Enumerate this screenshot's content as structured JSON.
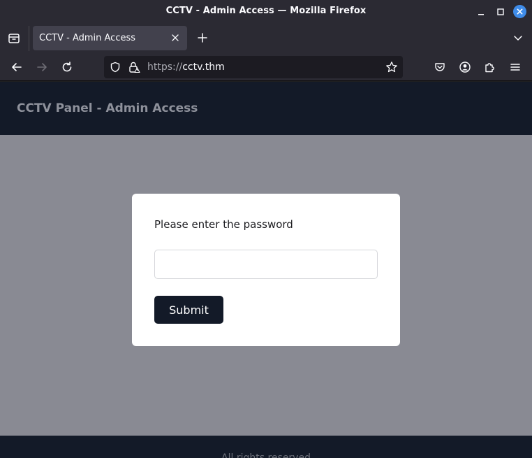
{
  "window": {
    "title": "CCTV - Admin Access — Mozilla Firefox"
  },
  "tabs": [
    {
      "label": "CCTV - Admin Access",
      "active": true
    }
  ],
  "toolbar": {
    "url_protocol": "https://",
    "url_host": "cctv.thm"
  },
  "site": {
    "header_title": "CCTV Panel - Admin Access",
    "form": {
      "prompt": "Please enter the password",
      "password_value": "",
      "submit_label": "Submit"
    },
    "footer_text": "All rights reserved"
  },
  "colors": {
    "browser_chrome": "#2b2a33",
    "active_tab": "#42414d",
    "site_header": "#131a28",
    "page_background": "#898a93",
    "accent_close": "#3f8ce9"
  }
}
